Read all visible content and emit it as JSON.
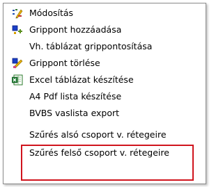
{
  "menu": {
    "items": [
      {
        "label": "Módosítás",
        "icon": "edit-icon"
      },
      {
        "label": "Grippont hozzáadása",
        "icon": "add-grippoint-icon"
      },
      {
        "label": "Vh. táblázat grippontosítása",
        "icon": ""
      },
      {
        "label": "Grippont törlése",
        "icon": "delete-grippoint-icon"
      },
      {
        "label": "Excel táblázat készítése",
        "icon": "excel-icon"
      },
      {
        "label": "A4 Pdf lista készítése",
        "icon": ""
      },
      {
        "label": "BVBS vaslista export",
        "icon": ""
      },
      {
        "label": "Szűrés alsó csoport v. rétegeire",
        "icon": ""
      },
      {
        "label": "Szűrés felső csoport v. rétegeire",
        "icon": ""
      }
    ]
  },
  "colors": {
    "highlight_border": "#d0141d"
  }
}
